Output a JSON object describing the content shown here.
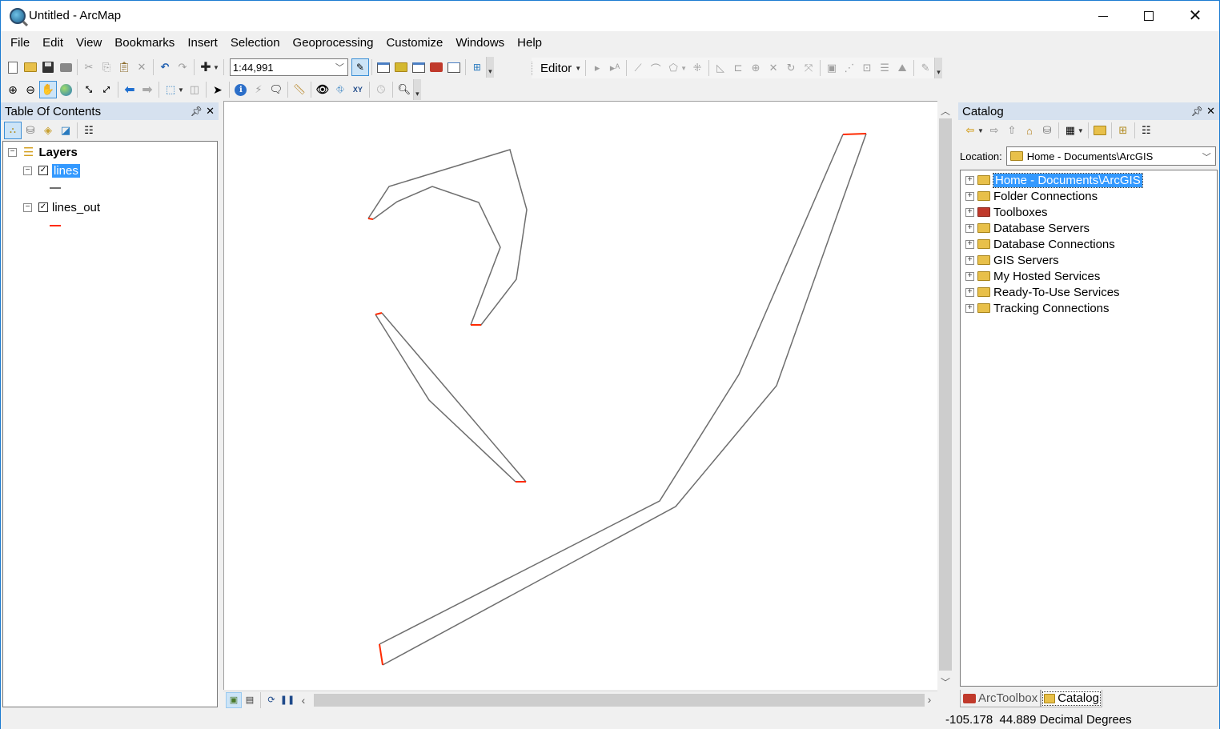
{
  "window": {
    "title": "Untitled - ArcMap",
    "controls": {
      "minimize": "minimize",
      "maximize": "maximize",
      "close": "close"
    }
  },
  "menubar": {
    "items": [
      "File",
      "Edit",
      "View",
      "Bookmarks",
      "Insert",
      "Selection",
      "Geoprocessing",
      "Customize",
      "Windows",
      "Help"
    ]
  },
  "standard_toolbar": {
    "scale": "1:44,991",
    "tools": [
      "new-document",
      "open",
      "save",
      "print",
      "cut",
      "copy",
      "paste",
      "delete",
      "undo",
      "redo",
      "add-data",
      "editor-toolbar",
      "table-of-contents",
      "catalog-window",
      "search-window",
      "arctoolbox",
      "python-window",
      "model-builder"
    ]
  },
  "tools_toolbar": {
    "tools": [
      "zoom-in",
      "zoom-out",
      "pan",
      "full-extent",
      "fixed-zoom-in",
      "fixed-zoom-out",
      "go-back",
      "go-forward",
      "select-features",
      "clear-selection",
      "select-elements",
      "identify",
      "hyperlink",
      "html-popup",
      "measure",
      "find",
      "find-route",
      "go-to-xy",
      "time-slider",
      "magnifier"
    ]
  },
  "editor_toolbar": {
    "label": "Editor",
    "tools": [
      "edit-tool",
      "annotation-edit",
      "straight-segment",
      "endpoint-arc",
      "construction-tools",
      "sketch-properties",
      "reshape",
      "cut-polygons",
      "split",
      "rotate",
      "scale",
      "edit-vertices",
      "attributes",
      "sketch-properties-2",
      "create-features"
    ]
  },
  "toc": {
    "title": "Table Of Contents",
    "pin": "auto-hide",
    "close": "close",
    "tools": [
      "list-by-drawing-order",
      "list-by-source",
      "list-by-visibility",
      "list-by-selection",
      "options"
    ],
    "root": {
      "label": "Layers",
      "expanded": true
    },
    "layers": [
      {
        "name": "lines",
        "checked": true,
        "selected": true,
        "symbol_color": "#6e6e6e"
      },
      {
        "name": "lines_out",
        "checked": true,
        "selected": false,
        "symbol_color": "#ff2a00"
      }
    ]
  },
  "map": {
    "layers_colors": {
      "lines": "#6e6e6e",
      "lines_out": "#ff2a00"
    },
    "footer_tools": [
      "data-view",
      "layout-view",
      "refresh",
      "pause-drawing"
    ]
  },
  "catalog": {
    "title": "Catalog",
    "pin": "auto-hide",
    "close": "close",
    "tools": [
      "back",
      "back-dropdown",
      "forward",
      "up-one-level",
      "home",
      "connect-database",
      "views",
      "views-dropdown",
      "connect-to-folder",
      "toggle-contents",
      "options"
    ],
    "location_label": "Location:",
    "location_value": "Home - Documents\\ArcGIS",
    "tree": [
      {
        "label": "Home - Documents\\ArcGIS",
        "icon": "home-folder-icon",
        "selected": true
      },
      {
        "label": "Folder Connections",
        "icon": "folder-connections-icon",
        "selected": false
      },
      {
        "label": "Toolboxes",
        "icon": "toolboxes-icon",
        "selected": false
      },
      {
        "label": "Database Servers",
        "icon": "database-servers-icon",
        "selected": false
      },
      {
        "label": "Database Connections",
        "icon": "database-connections-icon",
        "selected": false
      },
      {
        "label": "GIS Servers",
        "icon": "gis-servers-icon",
        "selected": false
      },
      {
        "label": "My Hosted Services",
        "icon": "hosted-services-icon",
        "selected": false
      },
      {
        "label": "Ready-To-Use Services",
        "icon": "ready-services-icon",
        "selected": false
      },
      {
        "label": "Tracking Connections",
        "icon": "tracking-connections-icon",
        "selected": false
      }
    ],
    "tabs": [
      {
        "label": "ArcToolbox",
        "active": false
      },
      {
        "label": "Catalog",
        "active": true
      }
    ]
  },
  "statusbar": {
    "coordinates": "-105.178  44.889 Decimal Degrees"
  }
}
